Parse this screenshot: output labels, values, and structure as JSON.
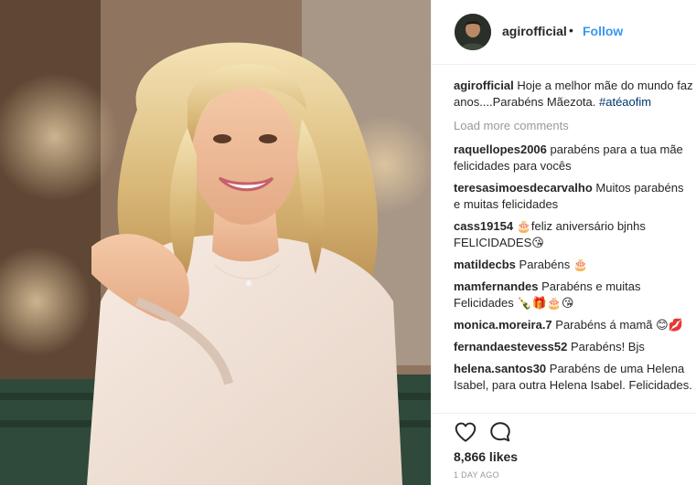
{
  "header": {
    "username": "agirofficial",
    "separator": "•",
    "follow_label": "Follow"
  },
  "caption": {
    "username": "agirofficial",
    "text": "Hoje a melhor mãe do mundo faz anos....Parabéns Mãezota.",
    "hashtag": "#atéaofim"
  },
  "load_more": "Load more comments",
  "comments": [
    {
      "username": "raquellopes2006",
      "text": "parabéns para a tua mãe felicidades para vocês"
    },
    {
      "username": "teresasimoesdecarvalho",
      "text": "Muitos parabéns e muitas felicidades"
    },
    {
      "username": "cass19154",
      "text": "🎂feliz aniversário bjnhs FELICIDADES😘"
    },
    {
      "username": "matildecbs",
      "text": "Parabéns 🎂"
    },
    {
      "username": "mamfernandes",
      "text": "Parabéns e muitas Felicidades 🍾🎁🎂😘"
    },
    {
      "username": "monica.moreira.7",
      "text": "Parabéns á mamã 😊💋"
    },
    {
      "username": "fernandaestevess52",
      "text": "Parabéns! Bjs"
    },
    {
      "username": "helena.santos30",
      "text": "Parabéns de uma Helena Isabel, para outra Helena Isabel. Felicidades."
    }
  ],
  "likes": "8,866 likes",
  "time": "1 DAY AGO",
  "icons": {
    "like": "heart-icon",
    "comment": "comment-icon"
  },
  "colors": {
    "follow": "#3897f0",
    "hashtag": "#003569",
    "muted": "#999999",
    "text": "#262626"
  }
}
